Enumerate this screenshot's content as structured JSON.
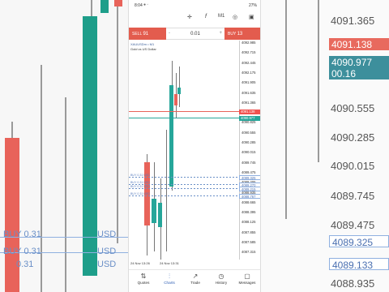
{
  "background": {
    "price_scale": [
      "4091.365",
      "4090.555",
      "4090.285",
      "4090.015",
      "4089.745",
      "4089.475",
      "4088.935"
    ],
    "price_tags": {
      "sell": "4091.138",
      "buy": "4090.977",
      "other": "00.16",
      "lower1": "4089.325",
      "lower2": "4089.133"
    },
    "order_labels": [
      "USD",
      "BUY 0.31",
      "BUY 0.31",
      "USD",
      "0.31",
      "USD"
    ]
  },
  "status_bar": {
    "time": "8:04",
    "right": "27%"
  },
  "toolbar": {
    "timeframe": "M1",
    "crosshair": "crosshair-icon",
    "indicators": "f"
  },
  "trade": {
    "sell_label": "SELL",
    "sell_price": "4091.138",
    "sell_big": "91",
    "buy_label": "BUY",
    "buy_price": "4090.977",
    "buy_big": "13",
    "lot": "0.01",
    "minus": "-",
    "plus": "+"
  },
  "chart": {
    "symbol": "XAUUSDm • M1",
    "description": "Gold vs US Dollar",
    "ticks": [
      "4092.985",
      "4092.715",
      "4092.445",
      "4092.175",
      "4091.905",
      "4091.635",
      "4091.365",
      "4091.095",
      "4090.825",
      "4090.555",
      "4090.285",
      "4090.015",
      "4089.745",
      "4089.475",
      "4089.205",
      "4088.935",
      "4088.665",
      "4088.395",
      "4088.125",
      "4087.855",
      "4087.585",
      "4087.315"
    ],
    "sell_tag": "4091.138",
    "buy_tag": "4090.977",
    "orders": [
      {
        "label": "BUY 0.31 USD"
      },
      {
        "label": "BUY 0.31 USD"
      },
      {
        "label": "BUY 0.31 USD"
      },
      {
        "label": "BUY 0.31 USD"
      }
    ],
    "order_tags": [
      "4089.325",
      "4089.270",
      "4089.215",
      "4088.767"
    ],
    "x_labels": [
      "24 Nov 13:26",
      "24 Nov 13:31"
    ]
  },
  "nav": [
    {
      "label": "Quotes",
      "icon": "quotes-icon",
      "glyph": "⇅"
    },
    {
      "label": "Charts",
      "icon": "charts-icon",
      "glyph": "⫶"
    },
    {
      "label": "Trade",
      "icon": "trade-icon",
      "glyph": "↗"
    },
    {
      "label": "History",
      "icon": "history-icon",
      "glyph": "◷"
    },
    {
      "label": "Messages",
      "icon": "messages-icon",
      "glyph": "▢"
    }
  ],
  "colors": {
    "bull": "#26a69a",
    "bear": "#ef5350",
    "accent": "#2c5db3",
    "sell": "#e35c4e"
  }
}
